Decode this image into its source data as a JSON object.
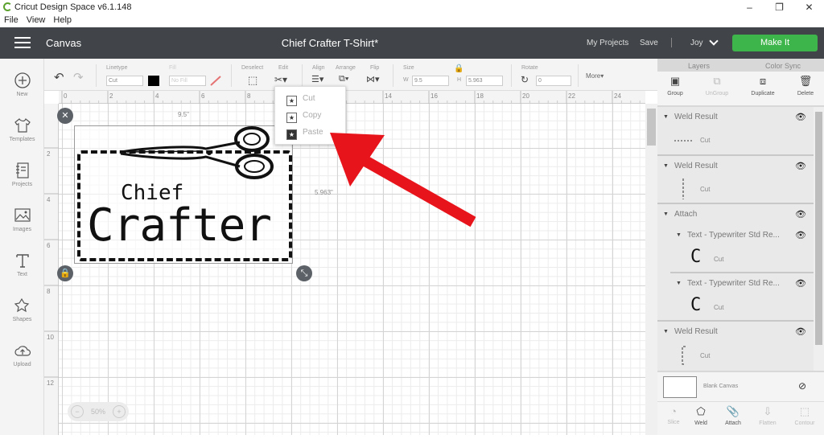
{
  "window": {
    "app_title": "Cricut Design Space  v6.1.148",
    "controls": [
      "–",
      "❐",
      "✕"
    ]
  },
  "menu": {
    "items": [
      "File",
      "View",
      "Help"
    ]
  },
  "header": {
    "section": "Canvas",
    "project_name": "Chief Crafter T-Shirt*",
    "my_projects": "My Projects",
    "save": "Save",
    "user": "Joy",
    "make_it": "Make It"
  },
  "leftbar": {
    "items": [
      {
        "label": "New",
        "icon": "plus-icon"
      },
      {
        "label": "Templates",
        "icon": "tshirt-icon"
      },
      {
        "label": "Projects",
        "icon": "notebook-icon"
      },
      {
        "label": "Images",
        "icon": "image-icon"
      },
      {
        "label": "Text",
        "icon": "text-icon"
      },
      {
        "label": "Shapes",
        "icon": "shapes-icon"
      },
      {
        "label": "Upload",
        "icon": "upload-icon"
      }
    ]
  },
  "toolbar": {
    "linetype_label": "Linetype",
    "linetype_value": "Cut",
    "fill_label": "Fill",
    "fill_value": "No Fill",
    "deselect_label": "Deselect",
    "edit_label": "Edit",
    "align_label": "Align",
    "arrange_label": "Arrange",
    "flip_label": "Flip",
    "size_label": "Size",
    "w_label": "W",
    "w_value": "9.5",
    "h_label": "H",
    "h_value": "5.963",
    "rotate_label": "Rotate",
    "rotate_value": "0",
    "more_label": "More▾",
    "linetype_color": "#000000"
  },
  "ruler": {
    "h_ticks": [
      "0",
      "2",
      "4",
      "6",
      "8",
      "10",
      "12",
      "14",
      "16",
      "18",
      "20",
      "22",
      "24"
    ],
    "v_ticks": [
      "2",
      "4",
      "6",
      "8",
      "10",
      "12"
    ]
  },
  "canvas": {
    "width_dim": "9.5\"",
    "height_dim": "5.963\"",
    "text_line1": "Chief",
    "text_line2": "Crafter",
    "zoom_value": "50%"
  },
  "context_menu": {
    "items": [
      {
        "label": "Cut",
        "state": "disabled"
      },
      {
        "label": "Copy",
        "state": "disabled"
      },
      {
        "label": "Paste",
        "state": "disabled"
      }
    ]
  },
  "right_panel": {
    "tabs": [
      "Layers",
      "Color Sync"
    ],
    "actions": [
      {
        "label": "Group",
        "icon": "group-icon",
        "enabled": true
      },
      {
        "label": "UnGroup",
        "icon": "ungroup-icon",
        "enabled": false
      },
      {
        "label": "Duplicate",
        "icon": "duplicate-icon",
        "enabled": true
      },
      {
        "label": "Delete",
        "icon": "trash-icon",
        "enabled": true
      }
    ],
    "layers": [
      {
        "name": "Weld Result",
        "sub": "Cut"
      },
      {
        "name": "Weld Result",
        "sub": "Cut"
      },
      {
        "name": "Attach",
        "children": [
          {
            "name": "Text - Typewriter Std Re...",
            "sub": "Cut",
            "glyph": "C"
          },
          {
            "name": "Text - Typewriter Std Re...",
            "sub": "Cut",
            "glyph": "C"
          }
        ]
      },
      {
        "name": "Weld Result",
        "sub": "Cut"
      }
    ],
    "blank_canvas": "Blank Canvas",
    "bottom_actions": [
      {
        "label": "Slice",
        "enabled": false
      },
      {
        "label": "Weld",
        "enabled": true
      },
      {
        "label": "Attach",
        "enabled": true
      },
      {
        "label": "Flatten",
        "enabled": false
      },
      {
        "label": "Contour",
        "enabled": false
      }
    ]
  },
  "colors": {
    "header_bg": "#414549",
    "make_it": "#3eb54a",
    "annotation_arrow": "#e8141b"
  }
}
